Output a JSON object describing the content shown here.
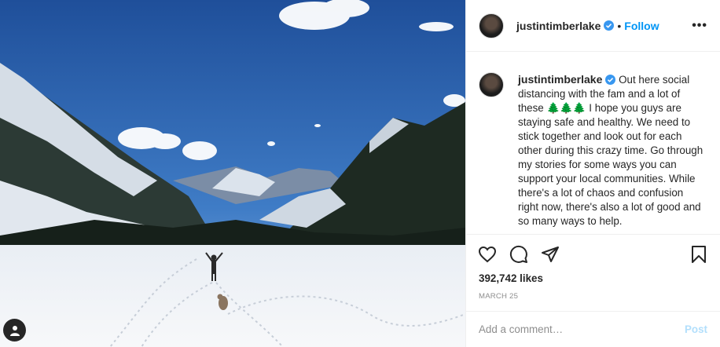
{
  "post": {
    "username": "justintimberlake",
    "follow_label": "Follow",
    "separator": "•",
    "more_label": "•••",
    "caption_username": "justintimberlake",
    "caption_part1": "Out here social distancing with the fam and a lot of these",
    "caption_trees": "🌲🌲🌲",
    "caption_part2": "I hope you guys are staying safe and healthy. We need to stick together and look out for each other during this crazy time. Go through my stories for some ways you can support your local communities. While there's a lot of chaos and confusion right now, there's also a lot of good and so many ways to help.",
    "likes": "392,742 likes",
    "date": "MARCH 25",
    "comment_placeholder": "Add a comment…",
    "post_label": "Post"
  },
  "icons": {
    "verified": "verified-badge-icon",
    "like": "heart-icon",
    "comment": "comment-bubble-icon",
    "share": "paper-plane-icon",
    "save": "bookmark-icon",
    "tag": "user-tag-icon"
  },
  "colors": {
    "accent": "#0095f6",
    "post_disabled": "#b2dffc",
    "muted": "#8e8e8e",
    "border": "#efefef"
  }
}
